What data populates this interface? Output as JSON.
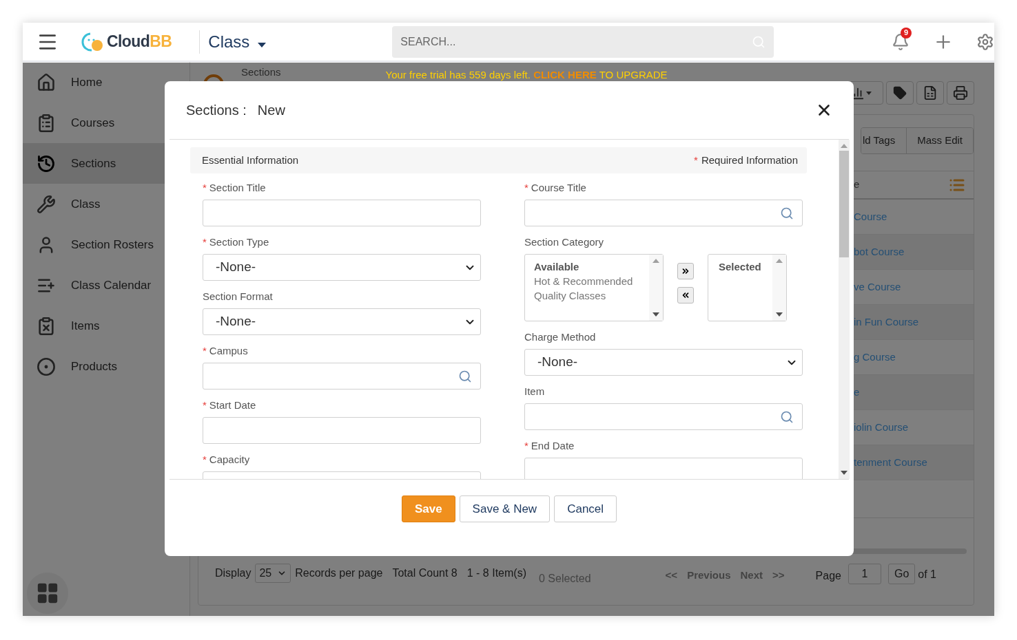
{
  "header": {
    "logo": {
      "main": "Cloud",
      "accent": "BB"
    },
    "module": "Class",
    "search": {
      "placeholder": "SEARCH..."
    },
    "notifications": "9"
  },
  "sidebar": {
    "items": [
      {
        "label": "Home",
        "selected": false
      },
      {
        "label": "Courses",
        "selected": false
      },
      {
        "label": "Sections",
        "selected": true
      },
      {
        "label": "Class",
        "selected": false
      },
      {
        "label": "Section Rosters",
        "selected": false
      },
      {
        "label": "Class Calendar",
        "selected": false
      },
      {
        "label": "Items",
        "selected": false
      },
      {
        "label": "Products",
        "selected": false
      }
    ]
  },
  "page": {
    "title": "Sections",
    "banner": {
      "text": "Your free trial has 559 days left.",
      "link": "CLICK HERE",
      "suffix": "TO UPGRADE"
    },
    "actions": [
      "ld Tags",
      "Mass Edit"
    ],
    "column_1": "e",
    "rows": [
      "Course",
      "bot Course",
      "ve Course",
      "in Fun Course",
      "g Course",
      "e",
      "iolin Course",
      "tenment Course"
    ],
    "footer": {
      "display_label": "Display",
      "page_size": "25",
      "per_page_label": "Records per page",
      "total": "Total Count 8",
      "range": "1 - 8 Item(s)",
      "selected_count": "0 Selected",
      "first": "<<",
      "previous": "Previous",
      "next": "Next",
      "last": ">>",
      "page_label": "Page",
      "page": "1",
      "go": "Go",
      "of": "of 1"
    }
  },
  "modal": {
    "title": "Sections :",
    "mode": "New",
    "section": "Essential Information",
    "required_mark": "*",
    "required_note": "Required Information",
    "left_fields": [
      {
        "label": "Section Title",
        "required": true,
        "kind": "text"
      },
      {
        "label": "Section Type",
        "required": true,
        "kind": "select",
        "value": "-None-"
      },
      {
        "label": "Section Format",
        "required": false,
        "kind": "select",
        "value": "-None-"
      },
      {
        "label": "Campus",
        "required": true,
        "kind": "lookup"
      },
      {
        "label": "Start Date",
        "required": true,
        "kind": "text"
      },
      {
        "label": "Capacity",
        "required": true,
        "kind": "text"
      }
    ],
    "right_fields": [
      {
        "label": "Course Title",
        "required": true,
        "kind": "lookup"
      },
      {
        "label": "Section Category",
        "required": false,
        "kind": "duallist",
        "available_title": "Available",
        "available": [
          "Hot & Recommended",
          "Quality Classes"
        ],
        "selected_title": "Selected"
      },
      {
        "label": "Charge Method",
        "required": false,
        "kind": "select",
        "value": "-None-"
      },
      {
        "label": "Item",
        "required": false,
        "kind": "lookup"
      },
      {
        "label": "End Date",
        "required": true,
        "kind": "text"
      }
    ],
    "buttons": [
      {
        "label": "Save",
        "primary": true
      },
      {
        "label": "Save & New",
        "primary": false
      },
      {
        "label": "Cancel",
        "primary": false
      }
    ]
  }
}
